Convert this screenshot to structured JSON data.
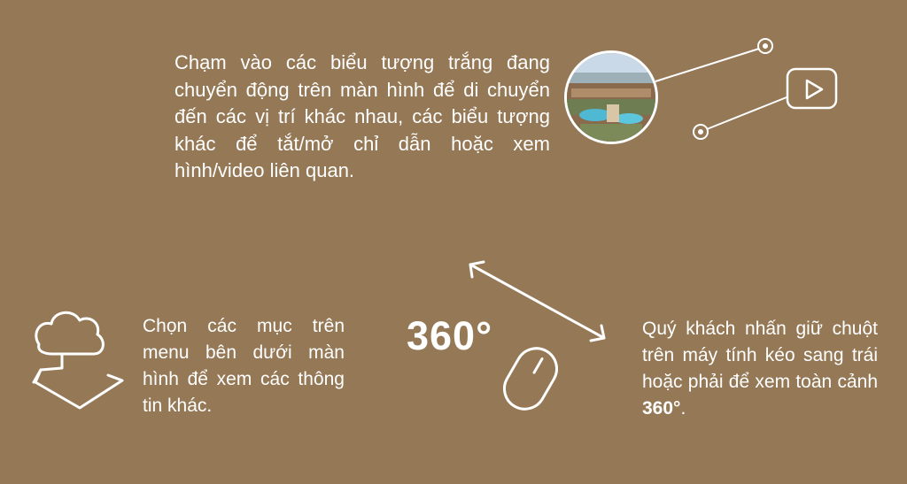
{
  "help": {
    "tap_instruction": "Chạm vào các biểu tượng trắng đang chuyển động trên màn hình để di chuyển đến các vị trí khác nhau, các biểu tượng khác để tắt/mở chỉ dẫn hoặc xem hình/video liên quan.",
    "menu_instruction": "Chọn các mục trên menu bên dưới màn hình để xem các thông tin khác.",
    "drag_instruction": "Quý khách nhấn giữ chuột trên máy tính kéo sang trái hoặc phải để xem toàn cảnh ",
    "drag_emphasis": "360°",
    "drag_end": ".",
    "degrees_label": "360°"
  },
  "icons": [
    "panorama-thumbnail-icon",
    "hotspot-circle-icon",
    "video-play-icon",
    "cloud-map-icon",
    "double-arrow-icon",
    "mouse-icon"
  ],
  "colors": {
    "background": "#957856",
    "foreground": "#ffffff"
  }
}
